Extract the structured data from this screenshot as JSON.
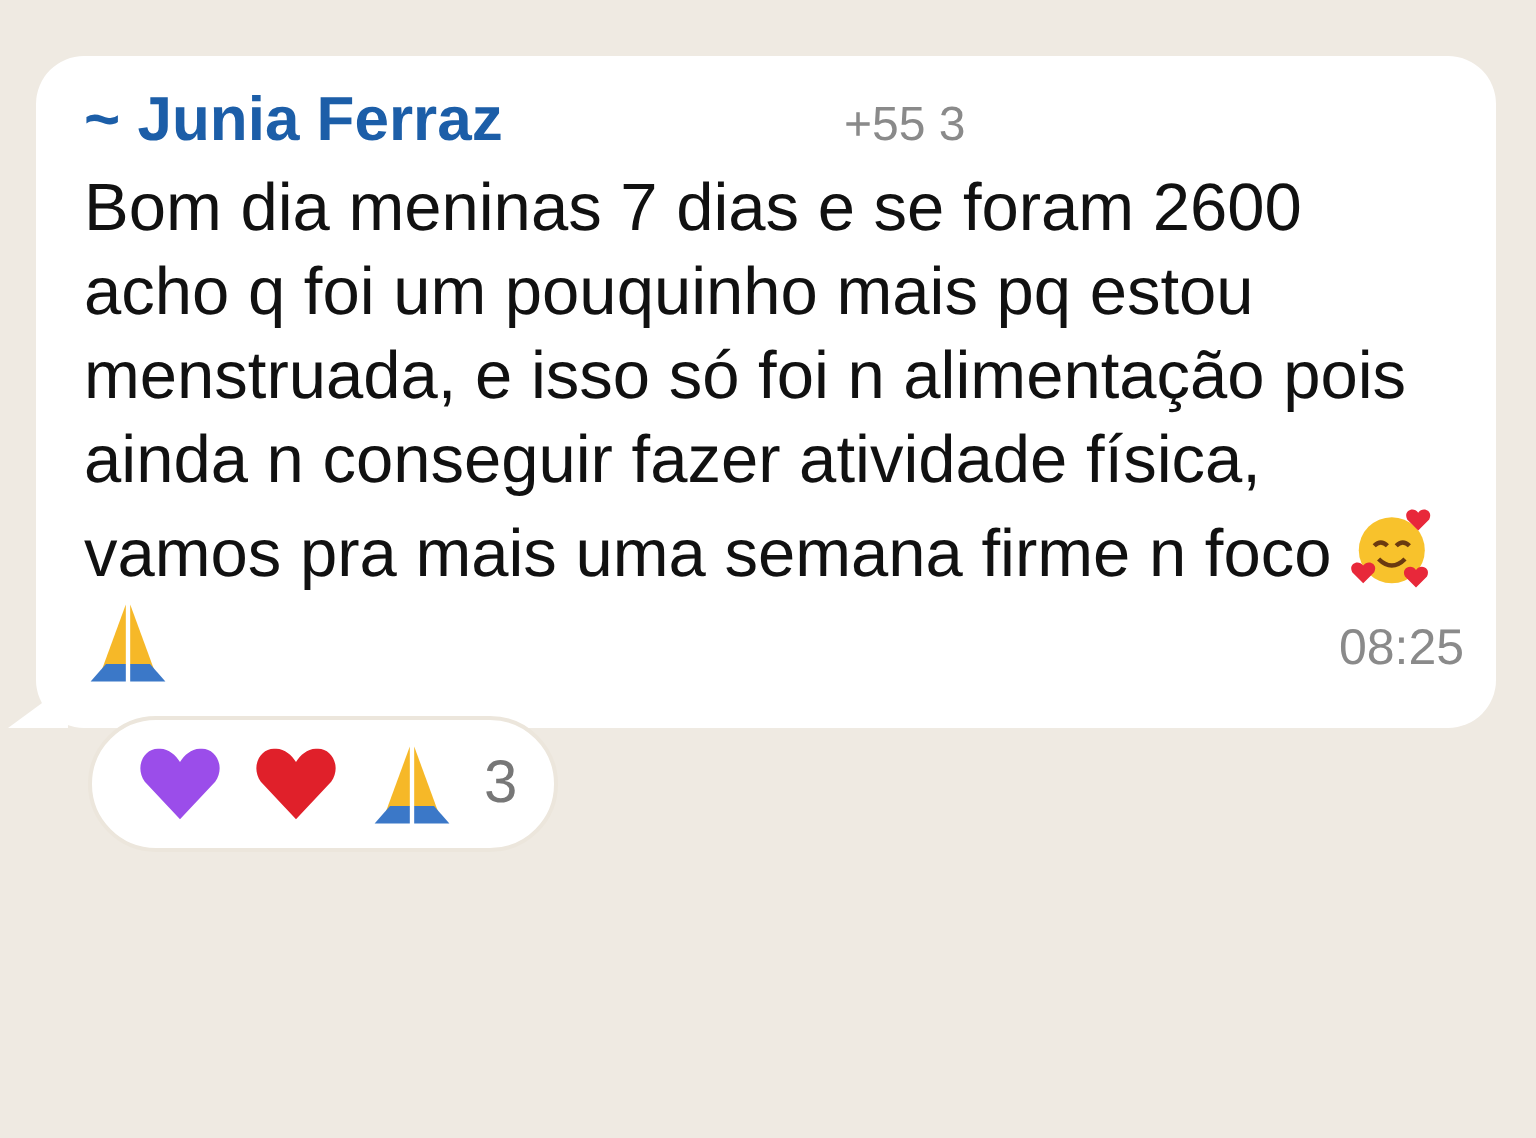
{
  "message": {
    "sender": "~ Junia Ferraz",
    "phone": "+55 3",
    "text": "Bom dia meninas 7 dias e se foram 2600 acho q foi um pouquinho mais pq estou menstruada, e isso só foi n alimentação pois ainda n conseguir fazer atividade física, vamos pra mais uma semana firme n foco",
    "emojis": [
      {
        "kind": "smiling-hearts"
      },
      {
        "kind": "praying-hands"
      }
    ],
    "time": "08:25"
  },
  "reactions": {
    "items": [
      {
        "kind": "heart",
        "color": "#9b4dea"
      },
      {
        "kind": "heart",
        "color": "#e0202a"
      },
      {
        "kind": "praying-hands"
      }
    ],
    "count": "3"
  }
}
